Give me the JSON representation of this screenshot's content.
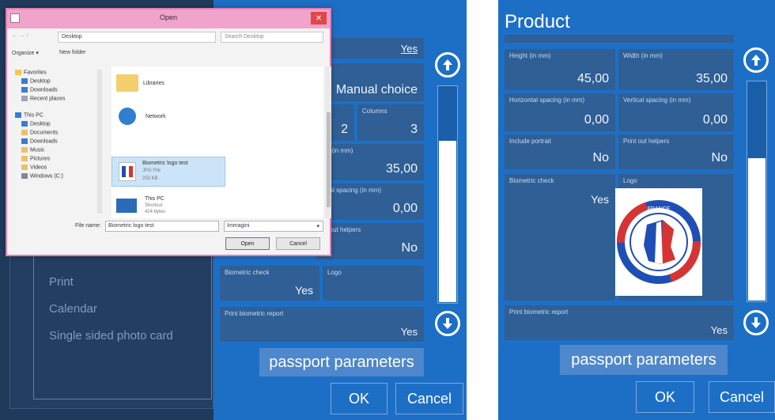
{
  "left": {
    "dialog": {
      "title": "Open",
      "close": "✕",
      "address": "Desktop",
      "search_placeholder": "Search Desktop",
      "organize": "Organize ▾",
      "new_folder": "New folder",
      "nav": [
        {
          "label": "Favorites"
        },
        {
          "label": "Desktop"
        },
        {
          "label": "Downloads"
        },
        {
          "label": "Recent places"
        },
        {
          "label": "This PC"
        },
        {
          "label": "Desktop"
        },
        {
          "label": "Documents"
        },
        {
          "label": "Downloads"
        },
        {
          "label": "Music"
        },
        {
          "label": "Pictures"
        },
        {
          "label": "Videos"
        },
        {
          "label": "Windows (C:)"
        }
      ],
      "files": {
        "libraries": "Libraries",
        "network": "Network",
        "selected_name": "Biometric logo test",
        "selected_type": "JPG File",
        "selected_size": "253 KB",
        "thispc_name": "This PC",
        "thispc_sub1": "Shortcut",
        "thispc_sub2": "424 bytes"
      },
      "file_name_label": "File name:",
      "file_name_value": "Biometric logo test",
      "file_type": "Immagini",
      "open_button": "Open",
      "cancel_button": "Cancel"
    },
    "menu": {
      "items": [
        "Print",
        "Calendar",
        "Single sided photo card"
      ]
    },
    "panel": {
      "yes_top": "Yes",
      "manual_choice": "Manual choice",
      "columns_label": "Columns",
      "rows_value": "2",
      "columns_value": "3",
      "width_label": "dth (in mm)",
      "width_value": "35,00",
      "vspacing_label": "rtical spacing (in mm)",
      "vspacing_value": "0,00",
      "helpers_label": "int out helpers",
      "helpers_value": "No",
      "biometric_label": "Biometric check",
      "biometric_value": "Yes",
      "logo_label": "Logo",
      "report_label": "Print biometric report",
      "report_value": "Yes",
      "passport_button": "passport parameters",
      "ok_button": "OK",
      "cancel_button": "Cancel"
    }
  },
  "right": {
    "title": "Product",
    "fields": {
      "height_label": "Height (in mm)",
      "height_value": "45,00",
      "width_label": "Width (in mm)",
      "width_value": "35,00",
      "hspacing_label": "Horizontal spacing (in mm)",
      "hspacing_value": "0,00",
      "vspacing_label": "Vertical spacing (in mm)",
      "vspacing_value": "0,00",
      "portrait_label": "Include portrait",
      "portrait_value": "No",
      "helpers_label": "Print out helpers",
      "helpers_value": "No",
      "biometric_label": "Biometric check",
      "biometric_value": "Yes",
      "logo_label": "Logo",
      "logo_text": "FRANCE",
      "report_label": "Print biometric report",
      "report_value": "Yes"
    },
    "passport_button": "passport parameters",
    "ok_button": "OK",
    "cancel_button": "Cancel",
    "scroll_position": 0.35
  },
  "colors": {
    "panel_blue": "#1d6fc6",
    "field_blue": "#2f5f95",
    "dark_navy": "#1f3a5b",
    "dialog_title": "#f0a4cc"
  },
  "icons": [
    "arrow-up-icon",
    "arrow-down-icon",
    "close-icon",
    "folder-icon",
    "network-icon",
    "computer-icon",
    "france-logo-icon"
  ]
}
